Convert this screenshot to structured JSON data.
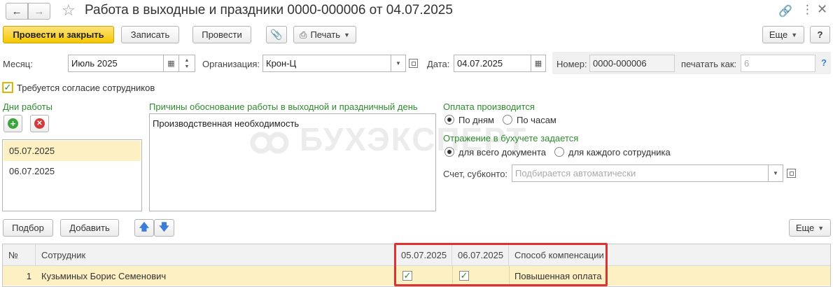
{
  "window": {
    "title": "Работа в выходные и праздники 0000-000006 от 04.07.2025"
  },
  "toolbar": {
    "post_close": "Провести и закрыть",
    "save": "Записать",
    "post": "Провести",
    "print": "Печать",
    "more": "Еще",
    "help": "?"
  },
  "form": {
    "month_label": "Месяц:",
    "month_value": "Июль 2025",
    "org_label": "Организация:",
    "org_value": "Крон-Ц",
    "date_label": "Дата:",
    "date_value": "04.07.2025",
    "number_label": "Номер:",
    "number_value": "0000-000006",
    "print_as_label": "печатать как:",
    "print_as_placeholder": "6",
    "print_as_help": "?",
    "consent_label": "Требуется согласие сотрудников",
    "consent_checked": true
  },
  "days": {
    "title": "Дни работы",
    "items": [
      "05.07.2025",
      "06.07.2025"
    ]
  },
  "reasons": {
    "title": "Причины обоснование работы в выходной и праздничный день",
    "text": "Производственная необходимость"
  },
  "payment": {
    "title": "Оплата производится",
    "options": [
      "По дням",
      "По часам"
    ],
    "selected": 0
  },
  "accounting": {
    "title": "Отражение в бухучете задается",
    "options": [
      "для всего документа",
      "для каждого сотрудника"
    ],
    "selected": 0,
    "account_label": "Счет, субконто:",
    "account_placeholder": "Подбирается автоматически"
  },
  "watermark": "БУХЭКСПЕРТ",
  "table_toolbar": {
    "pick": "Подбор",
    "add": "Добавить",
    "more": "Еще"
  },
  "table": {
    "columns": [
      "№",
      "Сотрудник",
      "05.07.2025",
      "06.07.2025",
      "Способ компенсации"
    ],
    "rows": [
      {
        "n": "1",
        "employee": "Кузьминых Борис Семенович",
        "d1": true,
        "d2": true,
        "compensation": "Повышенная оплата"
      }
    ]
  },
  "colors": {
    "accent_yellow": "#f5c800",
    "section_green": "#2e8b2e",
    "highlight_red": "#e03030",
    "row_selected": "#fdf0c2"
  }
}
